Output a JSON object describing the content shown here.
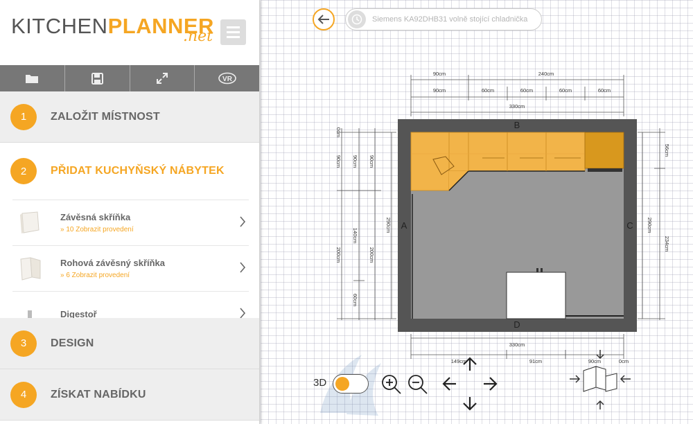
{
  "logo": {
    "part1": "KITCHEN",
    "part2": "PLANNER",
    "suffix": ".net"
  },
  "toolbar": {
    "tools": [
      "folder-icon",
      "save-icon",
      "fullscreen-icon",
      "vr-icon"
    ],
    "vr_label": "VR"
  },
  "steps": [
    {
      "num": "1",
      "label": "ZALOŽIT MÍSTNOST"
    },
    {
      "num": "2",
      "label": "PŘIDAT KUCHYŇSKÝ NÁBYTEK"
    },
    {
      "num": "3",
      "label": "DESIGN"
    },
    {
      "num": "4",
      "label": "ZÍSKAT NABÍDKU"
    }
  ],
  "furniture_items": [
    {
      "title": "Závěsná skříňka",
      "sub": "» 10 Zobrazit provedení"
    },
    {
      "title": "Rohová závěsný skříňka",
      "sub": "» 6 Zobrazit provedení"
    },
    {
      "title": "Digestoř",
      "sub": ""
    }
  ],
  "product": {
    "name": "Siemens KA92DHB31 volně stojící chladnička"
  },
  "plan": {
    "walls": {
      "top": "B",
      "left": "A",
      "right": "C",
      "bottom": "D"
    },
    "dims_top": [
      "90cm",
      "240cm",
      "90cm",
      "60cm",
      "60cm",
      "60cm",
      "60cm",
      "330cm"
    ],
    "dims_left": [
      "0cm",
      "90cm",
      "90cm",
      "90cm",
      "140cm",
      "200cm",
      "200cm",
      "60cm",
      "290cm"
    ],
    "dims_right": [
      "56cm",
      "290cm",
      "234cm"
    ],
    "dims_bottom": [
      "330cm",
      "149cm",
      "91cm",
      "90cm",
      "0cm"
    ]
  },
  "controls": {
    "toggle_label": "3D"
  },
  "colors": {
    "accent": "#f5a623",
    "cabinet": "#f2b449",
    "floor": "#999999",
    "wall": "#555555"
  }
}
